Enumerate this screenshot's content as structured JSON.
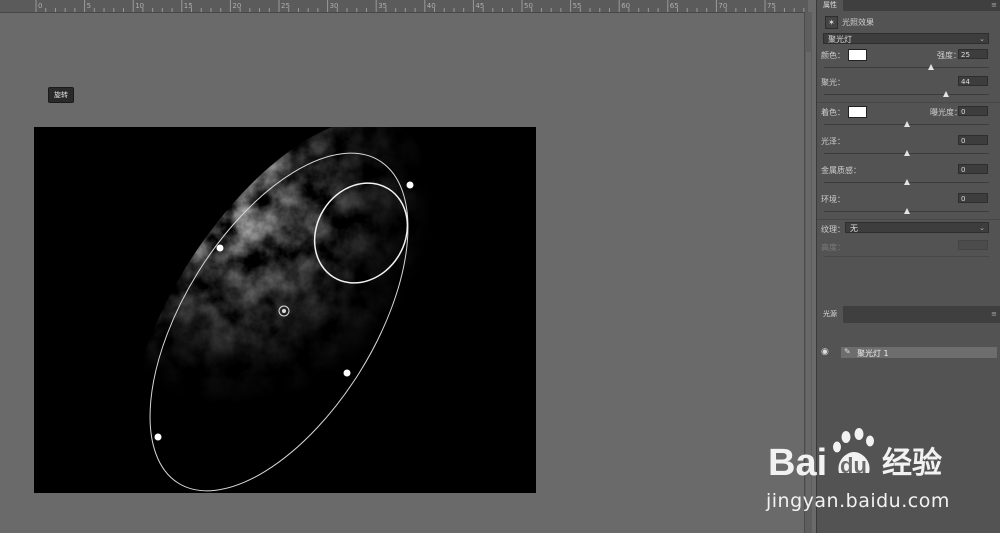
{
  "ruler": {
    "ticks": [
      "0",
      "5",
      "10",
      "15",
      "20",
      "25",
      "30",
      "35",
      "40",
      "45",
      "50",
      "55",
      "60",
      "65",
      "70",
      "75"
    ]
  },
  "tooltip": {
    "text": "旋转"
  },
  "properties": {
    "tab": "属性",
    "title": "光照效果",
    "preset": "聚光灯",
    "color_label": "颜色：",
    "intensity_label": "强度：",
    "intensity_value": "25",
    "hotspot_label": "聚光：",
    "hotspot_value": "44",
    "tint_label": "着色：",
    "exposure_label": "曝光度：",
    "exposure_value": "0",
    "gloss_label": "光泽：",
    "gloss_value": "0",
    "metallic_label": "金属质感：",
    "metallic_value": "0",
    "ambience_label": "环境：",
    "ambience_value": "0",
    "texture_label": "纹理：",
    "texture_value": "无",
    "height_label": "高度：",
    "swatch_color": "#ffffff",
    "slider_levels": {
      "intensity": 0.65,
      "hotspot": 0.74,
      "exposure": 0.5,
      "gloss": 0.5,
      "metallic": 0.5,
      "ambience": 0.5
    }
  },
  "lights": {
    "tab": "光源",
    "items": [
      {
        "name": "聚光灯 1"
      }
    ]
  },
  "watermark": {
    "url": "jingyan.baidu.com"
  }
}
